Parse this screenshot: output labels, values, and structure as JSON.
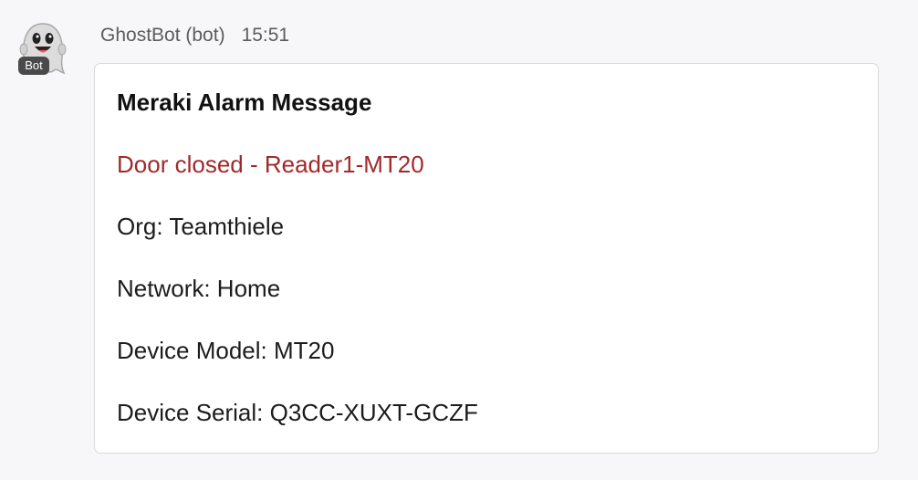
{
  "message": {
    "sender": "GhostBot (bot)",
    "time": "15:51",
    "avatar": {
      "badge": "Bot",
      "icon": "ghost-icon"
    }
  },
  "card": {
    "title": "Meraki Alarm Message",
    "alarm": "Door closed - Reader1-MT20",
    "org": "Org: Teamthiele",
    "network": "Network: Home",
    "device_model": "Device Model: MT20",
    "device_serial": "Device Serial: Q3CC-XUXT-GCZF"
  },
  "colors": {
    "alarm_text": "#a02a2a",
    "background": "#f7f7f9",
    "card_border": "#d9d9d9"
  }
}
